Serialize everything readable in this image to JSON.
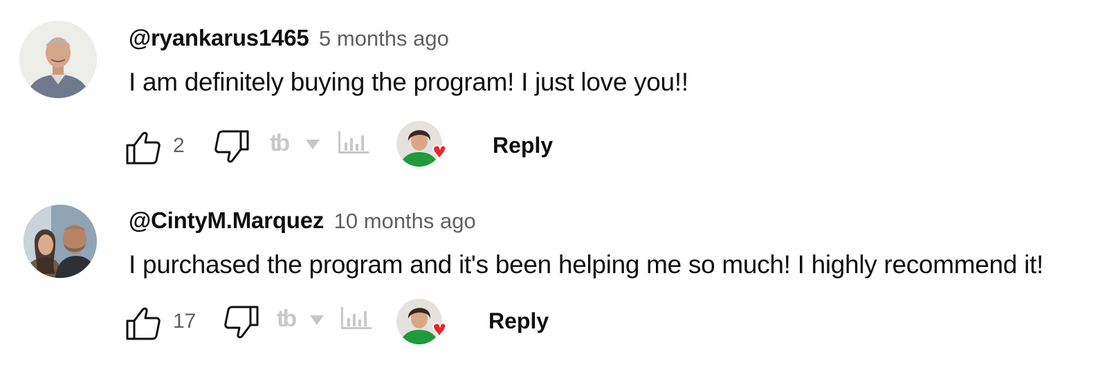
{
  "comments": [
    {
      "author": "@ryankarus1465",
      "time": "5 months ago",
      "text": "I am definitely buying the program! I just love you!!",
      "likes": "2",
      "reply_label": "Reply",
      "avatar_icon": "user-avatar-man",
      "hearted": true
    },
    {
      "author": "@CintyM.Marquez",
      "time": "10 months ago",
      "text": "I purchased the program and it's been helping me so much! I highly recommend it!",
      "likes": "17",
      "reply_label": "Reply",
      "avatar_icon": "user-avatar-couple",
      "hearted": true
    }
  ],
  "icons": {
    "like": "thumbs-up-icon",
    "dislike": "thumbs-down-icon",
    "tubebuddy": "tubebuddy-logo-icon",
    "stats": "bar-chart-icon",
    "heart": "heart-icon"
  },
  "extension_logo_text": "tb",
  "colors": {
    "text": "#0f0f0f",
    "secondary": "#606060",
    "muted_icon": "#c8c8c8",
    "heart": "#e8262d",
    "creator_jacket": "#1f9a3d"
  }
}
